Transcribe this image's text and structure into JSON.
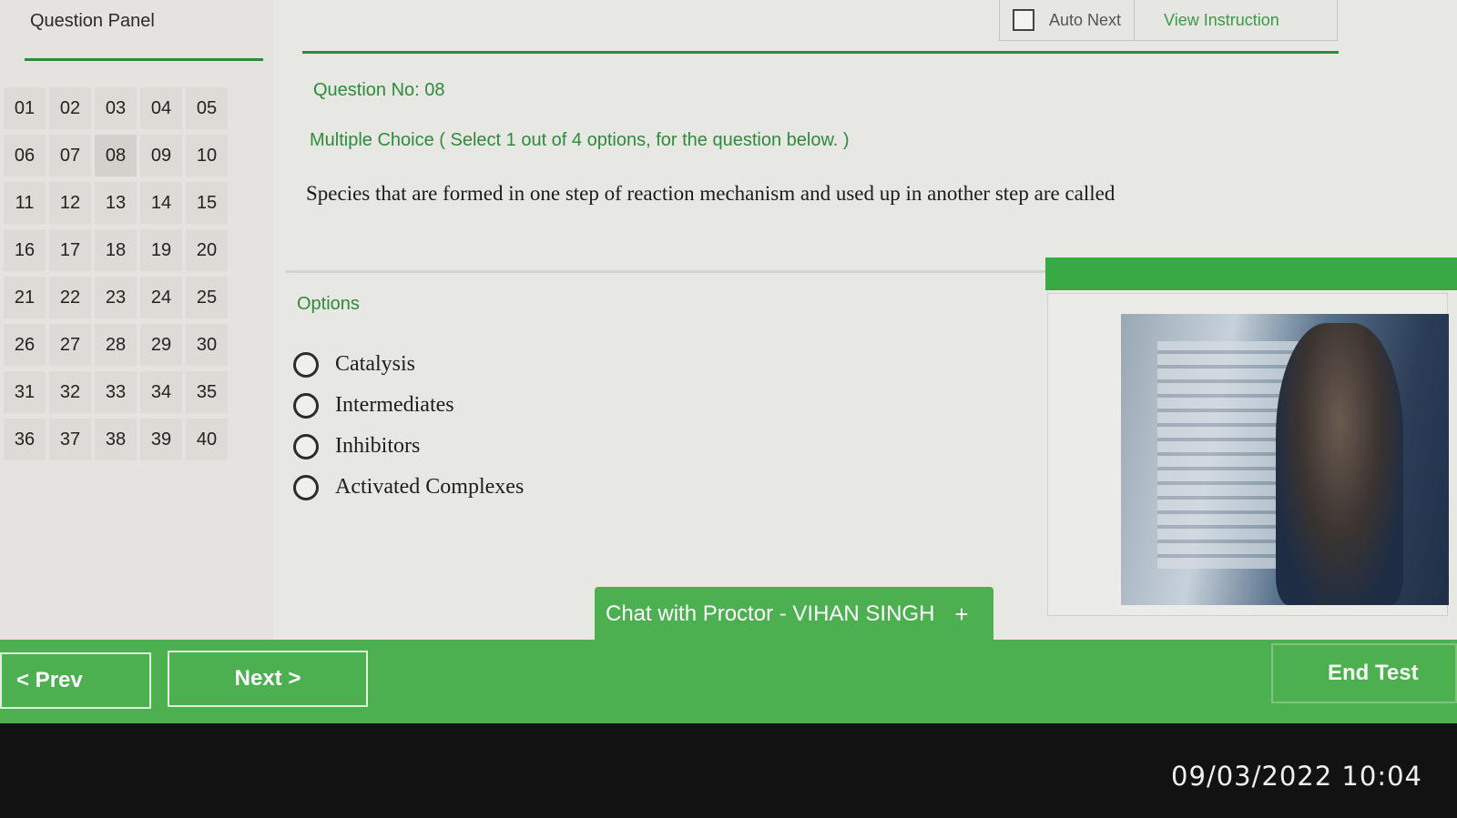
{
  "panel": {
    "title": "Question Panel",
    "questions": [
      "01",
      "02",
      "03",
      "04",
      "05",
      "06",
      "07",
      "08",
      "09",
      "10",
      "11",
      "12",
      "13",
      "14",
      "15",
      "16",
      "17",
      "18",
      "19",
      "20",
      "21",
      "22",
      "23",
      "24",
      "25",
      "26",
      "27",
      "28",
      "29",
      "30",
      "31",
      "32",
      "33",
      "34",
      "35",
      "36",
      "37",
      "38",
      "39",
      "40"
    ],
    "current": "08"
  },
  "toolbar": {
    "auto_next_label": "Auto Next",
    "view_instruction_label": "View Instruction"
  },
  "question": {
    "number_label": "Question No: 08",
    "type_label": "Multiple Choice ( Select 1 out of 4 options, for the question below. )",
    "text": "Species that are formed in one step of reaction mechanism and used up in another step are called"
  },
  "options": {
    "title": "Options",
    "items": [
      "Catalysis",
      "Intermediates",
      "Inhibitors",
      "Activated Complexes"
    ]
  },
  "chat": {
    "label": "Chat with Proctor - VIHAN SINGH",
    "plus": "+"
  },
  "nav": {
    "prev_label": "< Prev",
    "next_label": "Next >",
    "end_label": "End Test"
  },
  "timestamp": "09/03/2022 10:04",
  "colors": {
    "accent_green": "#4caf50",
    "text_green": "#2e8b3a"
  }
}
